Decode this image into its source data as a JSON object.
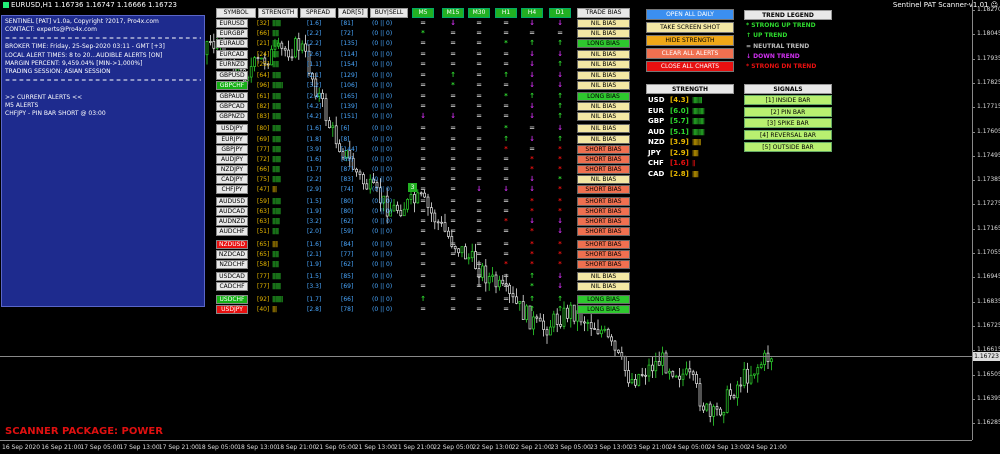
{
  "chart": {
    "title": "EURUSD,H1  1.16736 1.16747 1.16666 1.16723",
    "indicator": "Sentinel PAT Scanner-v1.01 ☺",
    "current_price": "1.16723",
    "price_ticks": [
      "1.18270",
      "1.18045",
      "1.17935",
      "1.17825",
      "1.17715",
      "1.17605",
      "1.17495",
      "1.17385",
      "1.17275",
      "1.17165",
      "1.17055",
      "1.16945",
      "1.16835",
      "1.16725",
      "1.16615",
      "1.16505",
      "1.16395",
      "1.16285"
    ],
    "time_ticks": [
      "16 Sep 2020",
      "16 Sep 21:00",
      "17 Sep 05:00",
      "17 Sep 13:00",
      "17 Sep 21:00",
      "18 Sep 05:00",
      "18 Sep 13:00",
      "18 Sep 21:00",
      "21 Sep 05:00",
      "21 Sep 13:00",
      "21 Sep 21:00",
      "22 Sep 05:00",
      "22 Sep 13:00",
      "22 Sep 21:00",
      "23 Sep 05:00",
      "23 Sep 13:00",
      "23 Sep 21:00",
      "24 Sep 05:00",
      "24 Sep 13:00",
      "24 Sep 21:00"
    ]
  },
  "info_panel": {
    "lines": [
      "SENTINEL [PAT] v1.0a, Copyright ?2017, Pro4x.com",
      "CONTACT: experts@Pro4x.com",
      "= = = = = = = = = = = = = = = = = = = = = = = = = = = = = = = =",
      "BROKER TIME: Friday, 25-Sep-2020 03:11 - GMT [+3]",
      "LOCAL ALERT TIMES: 8 to 20...AUDIBLE ALERTS [ON]",
      "MARGIN PERCENT: 9,459.04%  [MIN->1,000%]",
      "TRADING SESSION: ASIAN SESSION",
      "= = = = = = = = = = = = = = = = = = = = = = = = = = = = = = = =",
      "",
      ">> CURRENT ALERTS <<",
      "M5 ALERTS",
      "CHFJPY - PIN BAR SHORT @ 03:00"
    ]
  },
  "scanner_package": "SCANNER PACKAGE: POWER",
  "headers": {
    "symbol": "SYMBOL",
    "strength": "STRENGTH",
    "spread": "SPREAD",
    "adr": "ADR[5]",
    "buysell": "BUY|SELL",
    "timeframes": [
      "M5",
      "M15",
      "M30",
      "H1",
      "H4",
      "D1"
    ],
    "trade_bias": "TRADE BIAS"
  },
  "rows": [
    {
      "sym": "EURUSD",
      "style": "",
      "str": "[32]",
      "bars": "||||||||",
      "spread": "[1.6]",
      "adr": "[81]",
      "bs": "(0 || 0)",
      "tf": [
        "=",
        "↓",
        "=",
        "=",
        "↓",
        "↓"
      ],
      "bias": "NIL BIAS",
      "bt": "nil"
    },
    {
      "sym": "EURGBP",
      "style": "",
      "str": "[66]",
      "bars": "||||||",
      "spread": "[2.2]",
      "adr": "[72]",
      "bs": "(0 || 0)",
      "tf": [
        "*",
        "=",
        "=",
        "=",
        "=",
        "="
      ],
      "bias": "NIL BIAS",
      "bt": "nil"
    },
    {
      "sym": "EURAUD",
      "style": "",
      "str": "[21]",
      "bars": "||||||",
      "spread": "[2.2]",
      "adr": "[135]",
      "bs": "(0 || 0)",
      "tf": [
        "=",
        "=",
        "=",
        "*",
        "↑",
        "↑"
      ],
      "bias": "LONG BIAS",
      "bt": "long"
    },
    {
      "sym": "EURCAD",
      "style": "",
      "str": "[24]",
      "bars": "||||||",
      "spread": "[2.6]",
      "adr": "[114]",
      "bs": "(0 || 0)",
      "tf": [
        "=",
        "=",
        "=",
        "=",
        "↓",
        "↓"
      ],
      "bias": "NIL BIAS",
      "bt": "nil"
    },
    {
      "sym": "EURNZD",
      "style": "",
      "str": "[25]",
      "bars": "||||||",
      "spread": "[1.1]",
      "adr": "[154]",
      "bs": "(0 || 0)",
      "tf": [
        "=",
        "=",
        "=",
        "=",
        "↓",
        "↑"
      ],
      "bias": "NIL BIAS",
      "bt": "nil"
    },
    {
      "sym": "GBPUSD",
      "style": "",
      "str": "[64]",
      "bars": "||||||||",
      "spread": "[2.1]",
      "adr": "[129]",
      "bs": "(0 || 0)",
      "tf": [
        "=",
        "↑",
        "=",
        "↑",
        "↓",
        "↓"
      ],
      "bias": "NIL BIAS",
      "bt": "nil"
    },
    {
      "sym": "GBPCHF",
      "style": "green",
      "str": "[96]",
      "bars": "||||||||||",
      "spread": "[3.2]",
      "adr": "[106]",
      "bs": "(0 || 0)",
      "tf": [
        "=",
        "*",
        "=",
        "=",
        "↓",
        "↓"
      ],
      "bias": "NIL BIAS",
      "bt": "nil"
    },
    {
      "sym": "GBPAUD",
      "style": "",
      "str": "[61]",
      "bars": "||||||||",
      "spread": "[2.4]",
      "adr": "[165]",
      "bs": "(0 || 0)",
      "tf": [
        "=",
        "=",
        "=",
        "*",
        "↑",
        "↑"
      ],
      "bias": "LONG BIAS",
      "bt": "long"
    },
    {
      "sym": "GBPCAD",
      "style": "",
      "str": "[82]",
      "bars": "||||||||",
      "spread": "[4.2]",
      "adr": "[139]",
      "bs": "(0 || 0)",
      "tf": [
        "=",
        "=",
        "=",
        "=",
        "↓",
        "↑"
      ],
      "bias": "NIL BIAS",
      "bt": "nil"
    },
    {
      "sym": "GBPNZD",
      "style": "",
      "str": "[83]",
      "bars": "||||||||",
      "spread": "[4.2]",
      "adr": "[151]",
      "bs": "(0 || 0)",
      "tf": [
        "↓",
        "↓",
        "=",
        "=",
        "↓",
        "↑"
      ],
      "bias": "NIL BIAS",
      "bt": "nil"
    },
    {
      "sym": "USDJPY",
      "style": "",
      "str": "[80]",
      "bars": "||||||||",
      "spread": "[1.6]",
      "adr": "[6]",
      "bs": "(0 || 0)",
      "tf": [
        "=",
        "=",
        "=",
        "*",
        "=",
        "↓"
      ],
      "bias": "NIL BIAS",
      "bt": "nil"
    },
    {
      "sym": "EURJPY",
      "style": "",
      "str": "[69]",
      "bars": "||||||||",
      "spread": "[1.8]",
      "adr": "[8]",
      "bs": "(0 || 0)",
      "tf": [
        "=",
        "=",
        "=",
        "↑",
        "↓",
        "↑"
      ],
      "bias": "NIL BIAS",
      "bt": "nil"
    },
    {
      "sym": "GBPJPY",
      "style": "",
      "str": "[77]",
      "bars": "||||||||",
      "spread": "[3.9]",
      "adr": "[144]",
      "bs": "(0 || 0)",
      "tf": [
        "=",
        "=",
        "=",
        "*",
        "=",
        "*"
      ],
      "bias": "SHORT BIAS",
      "bt": "short"
    },
    {
      "sym": "AUDJPY",
      "style": "",
      "str": "[72]",
      "bars": "||||||||",
      "spread": "[1.6]",
      "adr": "[89]",
      "bs": "(0 || 0)",
      "tf": [
        "=",
        "=",
        "=",
        "=",
        "*",
        "*"
      ],
      "bias": "SHORT BIAS",
      "bt": "short"
    },
    {
      "sym": "NZDJPY",
      "style": "",
      "str": "[66]",
      "bars": "|||||||",
      "spread": "[1.7]",
      "adr": "[87]",
      "bs": "(0 || 0)",
      "tf": [
        "=",
        "=",
        "=",
        "=",
        "*",
        "*"
      ],
      "bias": "SHORT BIAS",
      "bt": "short"
    },
    {
      "sym": "CADJPY",
      "style": "",
      "str": "[75]",
      "bars": "||||||||",
      "spread": "[2.2]",
      "adr": "[83]",
      "bs": "(0 || 0)",
      "tf": [
        "=",
        "=",
        "=",
        "=",
        "↓",
        "*"
      ],
      "bias": "NIL BIAS",
      "bt": "nil"
    },
    {
      "sym": "CHFJPY",
      "style": "",
      "str": "[47]",
      "bars": "||||",
      "spread": "[2.9]",
      "adr": "[74]",
      "bs": "(0 || 0)",
      "tf": [
        "=",
        "=",
        "↓",
        "↓",
        "↓",
        "*"
      ],
      "bias": "SHORT BIAS",
      "bt": "short"
    },
    {
      "sym": "AUDUSD",
      "style": "",
      "str": "[59]",
      "bars": "||||||||",
      "spread": "[1.5]",
      "adr": "[80]",
      "bs": "(0 || 0)",
      "tf": [
        "=",
        "=",
        "=",
        "=",
        "*",
        "*"
      ],
      "bias": "SHORT BIAS",
      "bt": "short"
    },
    {
      "sym": "AUDCAD",
      "style": "",
      "str": "[63]",
      "bars": "||||||||",
      "spread": "[1.9]",
      "adr": "[80]",
      "bs": "(0 || 0)",
      "tf": [
        "=",
        "=",
        "=",
        "=",
        "*",
        "*"
      ],
      "bias": "SHORT BIAS",
      "bt": "short"
    },
    {
      "sym": "AUDNZD",
      "style": "",
      "str": "[63]",
      "bars": "|||||||",
      "spread": "[3.2]",
      "adr": "[62]",
      "bs": "(0 || 0)",
      "tf": [
        "=",
        "=",
        "=",
        "*",
        "↓",
        "↓"
      ],
      "bias": "SHORT BIAS",
      "bt": "short"
    },
    {
      "sym": "AUDCHF",
      "style": "",
      "str": "[51]",
      "bars": "||||||",
      "spread": "[2.0]",
      "adr": "[59]",
      "bs": "(0 || 0)",
      "tf": [
        "=",
        "=",
        "=",
        "=",
        "*",
        "↓"
      ],
      "bias": "SHORT BIAS",
      "bt": "short"
    },
    {
      "sym": "NZDUSD",
      "style": "red",
      "str": "[65]",
      "bars": "|||||",
      "spread": "[1.6]",
      "adr": "[84]",
      "bs": "(0 || 0)",
      "tf": [
        "=",
        "=",
        "=",
        "=",
        "*",
        "*"
      ],
      "bias": "SHORT BIAS",
      "bt": "short"
    },
    {
      "sym": "NZDCAD",
      "style": "",
      "str": "[65]",
      "bars": "||||||",
      "spread": "[2.1]",
      "adr": "[77]",
      "bs": "(0 || 0)",
      "tf": [
        "=",
        "=",
        "=",
        "=",
        "*",
        "*"
      ],
      "bias": "SHORT BIAS",
      "bt": "short"
    },
    {
      "sym": "NZDCHF",
      "style": "",
      "str": "[58]",
      "bars": "||||||",
      "spread": "[1.9]",
      "adr": "[62]",
      "bs": "(0 || 0)",
      "tf": [
        "=",
        "=",
        "=",
        "*",
        "*",
        "*"
      ],
      "bias": "SHORT BIAS",
      "bt": "short"
    },
    {
      "sym": "USDCAD",
      "style": "",
      "str": "[77]",
      "bars": "||||||||",
      "spread": "[1.5]",
      "adr": "[85]",
      "bs": "(0 || 0)",
      "tf": [
        "=",
        "=",
        "=",
        "=",
        "↑",
        "↓"
      ],
      "bias": "NIL BIAS",
      "bt": "nil"
    },
    {
      "sym": "CADCHF",
      "style": "",
      "str": "[77]",
      "bars": "||||||||",
      "spread": "[3.3]",
      "adr": "[69]",
      "bs": "(0 || 0)",
      "tf": [
        "=",
        "=",
        "=",
        "=",
        "*",
        "↓"
      ],
      "bias": "NIL BIAS",
      "bt": "nil"
    },
    {
      "sym": "USDCHF",
      "style": "green",
      "str": "[92]",
      "bars": "||||||||||",
      "spread": "[1.7]",
      "adr": "[66]",
      "bs": "(0 || 0)",
      "tf": [
        "↑",
        "=",
        "=",
        "=",
        "↑",
        "↑"
      ],
      "bias": "LONG BIAS",
      "bt": "long"
    },
    {
      "sym": "USDJPY",
      "style": "red",
      "str": "[40]",
      "bars": "||||",
      "spread": "[2.8]",
      "adr": "[78]",
      "bs": "(0 || 0)",
      "tf": [
        "=",
        "=",
        "=",
        "=",
        "↑",
        "↑"
      ],
      "bias": "LONG BIAS",
      "bt": "long"
    }
  ],
  "actions": [
    {
      "label": "OPEN ALL DAILY",
      "bg": "#3b8ff0",
      "fg": "#ffffff"
    },
    {
      "label": "TAKE SCREEN SHOT",
      "bg": "#f3e7a4",
      "fg": "#000000"
    },
    {
      "label": "HIDE STRENGTH",
      "bg": "#f0a818",
      "fg": "#000000"
    },
    {
      "label": "CLEAR ALL ALERTS",
      "bg": "#f07050",
      "fg": "#ffffff"
    },
    {
      "label": "CLOSE ALL CHARTS",
      "bg": "#e81010",
      "fg": "#ffffff"
    }
  ],
  "strength_panel": {
    "title": "STRENGTH",
    "rows": [
      {
        "cur": "USD",
        "val": "[4.3]",
        "bars": "||||||||",
        "color": "#e8b800",
        "bar_color": "#2ed82e"
      },
      {
        "cur": "EUR",
        "val": "[6.0]",
        "bars": "||||||||||",
        "color": "#2ed82e",
        "bar_color": "#2ed82e"
      },
      {
        "cur": "GBP",
        "val": "[5.7]",
        "bars": "||||||||||",
        "color": "#2ed82e",
        "bar_color": "#2ed82e"
      },
      {
        "cur": "AUD",
        "val": "[5.1]",
        "bars": "||||||||||",
        "color": "#2ed82e",
        "bar_color": "#2ed82e"
      },
      {
        "cur": "NZD",
        "val": "[3.9]",
        "bars": "|||||||",
        "color": "#e8b800",
        "bar_color": "#e8b800"
      },
      {
        "cur": "JPY",
        "val": "[2.9]",
        "bars": "|||||",
        "color": "#e8b800",
        "bar_color": "#e8b800"
      },
      {
        "cur": "CHF",
        "val": "[1.6]",
        "bars": "||",
        "color": "#e81010",
        "bar_color": "#e81010"
      },
      {
        "cur": "CAD",
        "val": "[2.8]",
        "bars": "|||||",
        "color": "#e8b800",
        "bar_color": "#e8b800"
      }
    ]
  },
  "legend": {
    "title": "TREND LEGEND",
    "rows": [
      {
        "sym": "*",
        "label": "STRONG UP TREND",
        "color": "#2ed82e"
      },
      {
        "sym": "↑",
        "label": "UP TREND",
        "color": "#2ed82e"
      },
      {
        "sym": "=",
        "label": "NEUTRAL TREND",
        "color": "#bbbbbb"
      },
      {
        "sym": "↓",
        "label": "DOWN TREND",
        "color": "#d030f0"
      },
      {
        "sym": "*",
        "label": "STRONG DN TREND",
        "color": "#e81010"
      }
    ]
  },
  "signals": {
    "title": "SIGNALS",
    "items": [
      "[1] INSIDE BAR",
      "[2] PIN BAR",
      "[3] SPIKE BAR",
      "[4] REVERSAL BAR",
      "[5] OUTSIDE BAR"
    ]
  },
  "badge": "3"
}
